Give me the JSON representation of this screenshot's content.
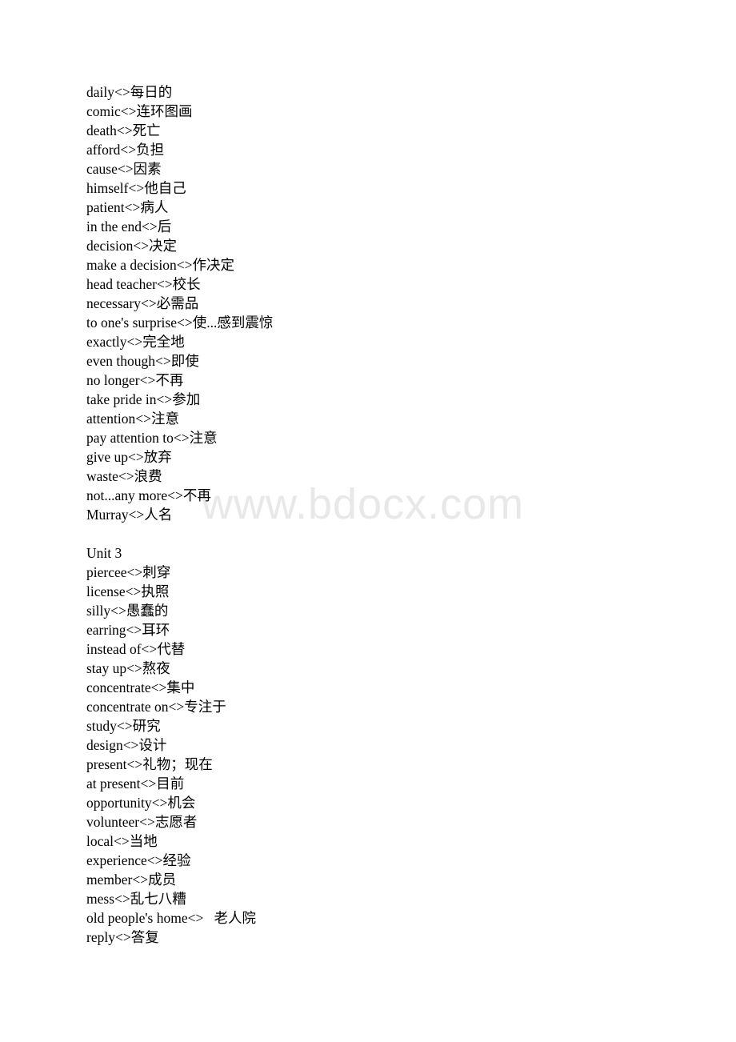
{
  "document": {
    "type": "vocabulary-word-list",
    "language_pair": "English-Chinese",
    "separator": "<>",
    "watermark": "www.bdocx.com",
    "background_color": "#ffffff",
    "text_color": "#000000",
    "watermark_color": "#e8e8e8"
  },
  "lines": [
    {
      "id": "l1",
      "kind": "entry",
      "text": "daily<>每日的"
    },
    {
      "id": "l2",
      "kind": "entry",
      "text": "comic<>连环图画"
    },
    {
      "id": "l3",
      "kind": "entry",
      "text": "death<>死亡"
    },
    {
      "id": "l4",
      "kind": "entry",
      "text": "afford<>负担"
    },
    {
      "id": "l5",
      "kind": "entry",
      "text": "cause<>因素"
    },
    {
      "id": "l6",
      "kind": "entry",
      "text": "himself<>他自己"
    },
    {
      "id": "l7",
      "kind": "entry",
      "text": "patient<>病人"
    },
    {
      "id": "l8",
      "kind": "entry",
      "text": "in the end<>后"
    },
    {
      "id": "l9",
      "kind": "entry",
      "text": "decision<>决定"
    },
    {
      "id": "l10",
      "kind": "entry",
      "text": "make a decision<>作决定"
    },
    {
      "id": "l11",
      "kind": "entry",
      "text": "head teacher<>校长"
    },
    {
      "id": "l12",
      "kind": "entry",
      "text": "necessary<>必需品"
    },
    {
      "id": "l13",
      "kind": "entry",
      "text": "to one's surprise<>使...感到震惊"
    },
    {
      "id": "l14",
      "kind": "entry",
      "text": "exactly<>完全地"
    },
    {
      "id": "l15",
      "kind": "entry",
      "text": "even though<>即使"
    },
    {
      "id": "l16",
      "kind": "entry",
      "text": "no longer<>不再"
    },
    {
      "id": "l17",
      "kind": "entry",
      "text": "take pride in<>参加"
    },
    {
      "id": "l18",
      "kind": "entry",
      "text": "attention<>注意"
    },
    {
      "id": "l19",
      "kind": "entry",
      "text": "pay attention to<>注意"
    },
    {
      "id": "l20",
      "kind": "entry",
      "text": "give up<>放弃"
    },
    {
      "id": "l21",
      "kind": "entry",
      "text": "waste<>浪费"
    },
    {
      "id": "l22",
      "kind": "entry",
      "text": "not...any more<>不再"
    },
    {
      "id": "l23",
      "kind": "entry",
      "text": "Murray<>人名"
    },
    {
      "id": "l24",
      "kind": "blank",
      "text": ""
    },
    {
      "id": "l25",
      "kind": "heading",
      "text": "Unit 3"
    },
    {
      "id": "l26",
      "kind": "entry",
      "text": "piercee<>刺穿"
    },
    {
      "id": "l27",
      "kind": "entry",
      "text": "license<>执照"
    },
    {
      "id": "l28",
      "kind": "entry",
      "text": "silly<>愚蠢的"
    },
    {
      "id": "l29",
      "kind": "entry",
      "text": "earring<>耳环"
    },
    {
      "id": "l30",
      "kind": "entry",
      "text": "instead of<>代替"
    },
    {
      "id": "l31",
      "kind": "entry",
      "text": "stay up<>熬夜"
    },
    {
      "id": "l32",
      "kind": "entry",
      "text": "concentrate<>集中"
    },
    {
      "id": "l33",
      "kind": "entry",
      "text": "concentrate on<>专注于"
    },
    {
      "id": "l34",
      "kind": "entry",
      "text": "study<>研究"
    },
    {
      "id": "l35",
      "kind": "entry",
      "text": "design<>设计"
    },
    {
      "id": "l36",
      "kind": "entry",
      "text": "present<>礼物；现在"
    },
    {
      "id": "l37",
      "kind": "entry",
      "text": "at present<>目前"
    },
    {
      "id": "l38",
      "kind": "entry",
      "text": "opportunity<>机会"
    },
    {
      "id": "l39",
      "kind": "entry",
      "text": "volunteer<>志愿者"
    },
    {
      "id": "l40",
      "kind": "entry",
      "text": "local<>当地"
    },
    {
      "id": "l41",
      "kind": "entry",
      "text": "experience<>经验"
    },
    {
      "id": "l42",
      "kind": "entry",
      "text": "member<>成员"
    },
    {
      "id": "l43",
      "kind": "entry",
      "text": "mess<>乱七八糟"
    },
    {
      "id": "l44",
      "kind": "entry",
      "text": "old people's home<>   老人院"
    },
    {
      "id": "l45",
      "kind": "entry",
      "text": "reply<>答复"
    }
  ]
}
